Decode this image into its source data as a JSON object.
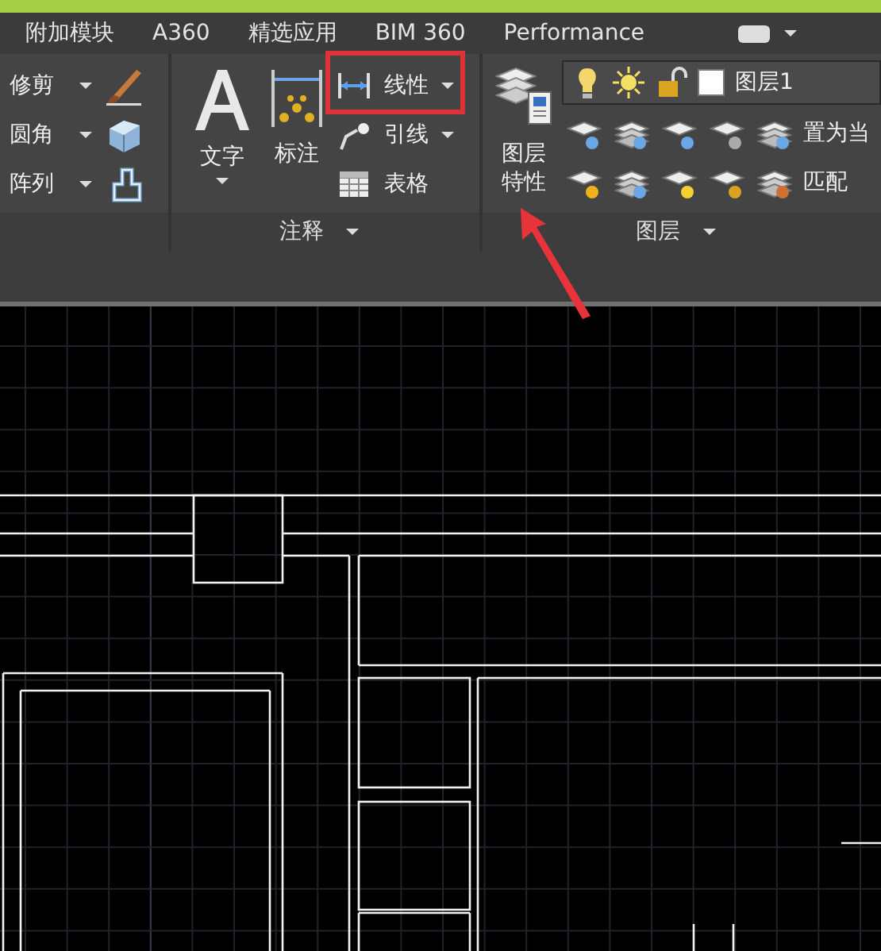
{
  "ribbon_tabs": [
    {
      "label": "附加模块"
    },
    {
      "label": "A360"
    },
    {
      "label": "精选应用"
    },
    {
      "label": "BIM 360"
    },
    {
      "label": "Performance"
    }
  ],
  "modify_panel": {
    "tools": [
      {
        "label": "修剪",
        "dropdown": true
      },
      {
        "label": "圆角",
        "dropdown": true
      },
      {
        "label": "阵列",
        "dropdown": true
      }
    ]
  },
  "annotation_panel": {
    "title": "注释",
    "large_tools": [
      {
        "label": "文字",
        "dropdown": true
      },
      {
        "label": "标注",
        "dropdown": false
      }
    ],
    "small_tools": [
      {
        "label": "线性",
        "dropdown": true
      },
      {
        "label": "引线",
        "dropdown": true
      },
      {
        "label": "表格",
        "dropdown": false
      }
    ]
  },
  "layers_panel": {
    "title": "图层",
    "properties_label": "图层特性",
    "current_layer": "图层1",
    "actions": [
      "置为当",
      "匹配"
    ]
  }
}
